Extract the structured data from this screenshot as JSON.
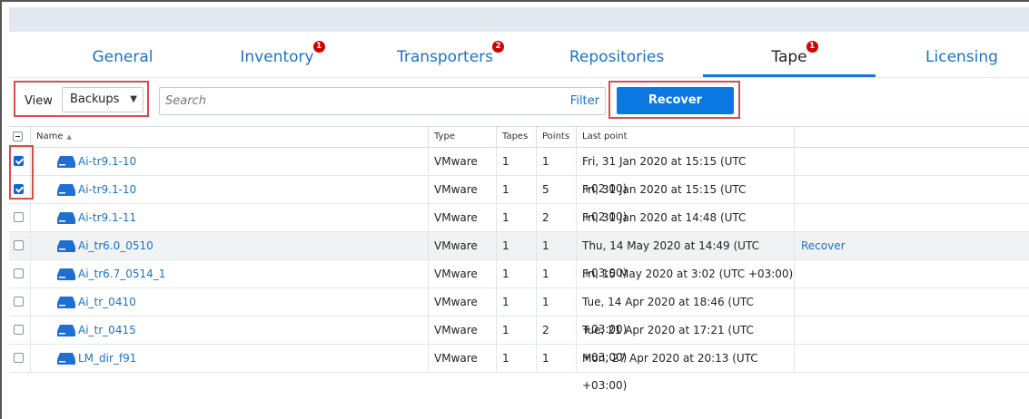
{
  "tabs": [
    {
      "label": "General",
      "badge": ""
    },
    {
      "label": "Inventory",
      "badge": "1"
    },
    {
      "label": "Transporters",
      "badge": "2"
    },
    {
      "label": "Repositories",
      "badge": ""
    },
    {
      "label": "Tape",
      "badge": "1",
      "active": true
    },
    {
      "label": "Licensing",
      "badge": ""
    }
  ],
  "toolbar": {
    "view_label": "View",
    "view_value": "Backups",
    "search_placeholder": "Search",
    "filter_label": "Filter",
    "recover_label": "Recover"
  },
  "table": {
    "columns": [
      "Name",
      "Type",
      "Tapes",
      "Points",
      "Last point",
      ""
    ],
    "rows": [
      {
        "checked": true,
        "name": "Ai-tr9.1-10",
        "type": "VMware",
        "tapes": "1",
        "points": "1",
        "last_point": "Fri, 31 Jan 2020 at 15:15 (UTC +02:00)",
        "action": ""
      },
      {
        "checked": true,
        "name": "Ai-tr9.1-10",
        "type": "VMware",
        "tapes": "1",
        "points": "5",
        "last_point": "Fri, 31 Jan 2020 at 15:15 (UTC +02:00)",
        "action": ""
      },
      {
        "checked": false,
        "name": "Ai-tr9.1-11",
        "type": "VMware",
        "tapes": "1",
        "points": "2",
        "last_point": "Fri, 31 Jan 2020 at 14:48 (UTC +02:00)",
        "action": ""
      },
      {
        "checked": false,
        "name": "Ai_tr6.0_0510",
        "type": "VMware",
        "tapes": "1",
        "points": "1",
        "last_point": "Thu, 14 May 2020 at 14:49 (UTC +03:00)",
        "action": "Recover",
        "highlight": true
      },
      {
        "checked": false,
        "name": "Ai_tr6.7_0514_1",
        "type": "VMware",
        "tapes": "1",
        "points": "1",
        "last_point": "Fri, 15 May 2020 at 3:02 (UTC +03:00)",
        "action": ""
      },
      {
        "checked": false,
        "name": "Ai_tr_0410",
        "type": "VMware",
        "tapes": "1",
        "points": "1",
        "last_point": "Tue, 14 Apr 2020 at 18:46 (UTC +03:00)",
        "action": ""
      },
      {
        "checked": false,
        "name": "Ai_tr_0415",
        "type": "VMware",
        "tapes": "1",
        "points": "2",
        "last_point": "Tue, 21 Apr 2020 at 17:21 (UTC +03:00)",
        "action": ""
      },
      {
        "checked": false,
        "name": "LM_dir_f91",
        "type": "VMware",
        "tapes": "1",
        "points": "1",
        "last_point": "Mon, 27 Apr 2020 at 20:13 (UTC +03:00)",
        "action": ""
      }
    ]
  },
  "colors": {
    "accent": "#1a73c8",
    "button": "#0a78e0",
    "badge": "#d10000",
    "highlight_border": "#d94c4c"
  }
}
